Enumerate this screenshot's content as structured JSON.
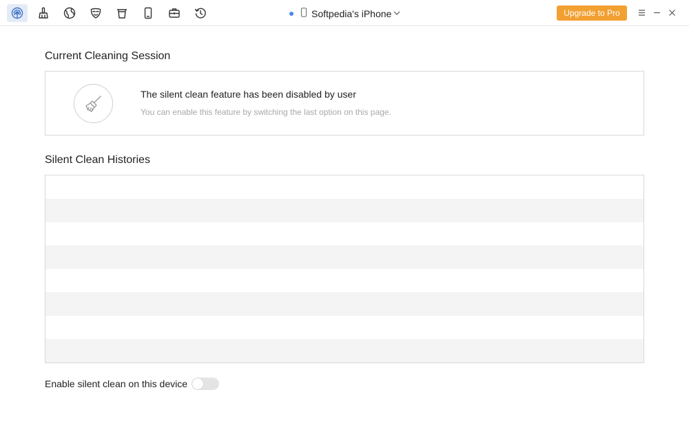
{
  "toolbar": {
    "tools": [
      {
        "icon": "airdrop-signal-icon",
        "active": true
      },
      {
        "icon": "cleaner-brush-icon",
        "active": false
      },
      {
        "icon": "globe-icon",
        "active": false
      },
      {
        "icon": "privacy-mask-icon",
        "active": false
      },
      {
        "icon": "trash-bin-icon",
        "active": false
      },
      {
        "icon": "phone-device-icon",
        "active": false
      },
      {
        "icon": "toolbox-icon",
        "active": false
      },
      {
        "icon": "history-clock-icon",
        "active": false
      }
    ],
    "device_name": "Softpedia's iPhone",
    "upgrade_label": "Upgrade to Pro",
    "accent_color": "#f2a032",
    "active_color": "#3e73c9"
  },
  "current_session": {
    "title": "Current Cleaning Session",
    "message": "The silent clean feature has been disabled by user",
    "hint": "You can enable this feature by switching the last option on this page."
  },
  "histories": {
    "title": "Silent Clean Histories",
    "rows": []
  },
  "settings": {
    "enable_label": "Enable silent clean on this device",
    "enabled": false
  }
}
